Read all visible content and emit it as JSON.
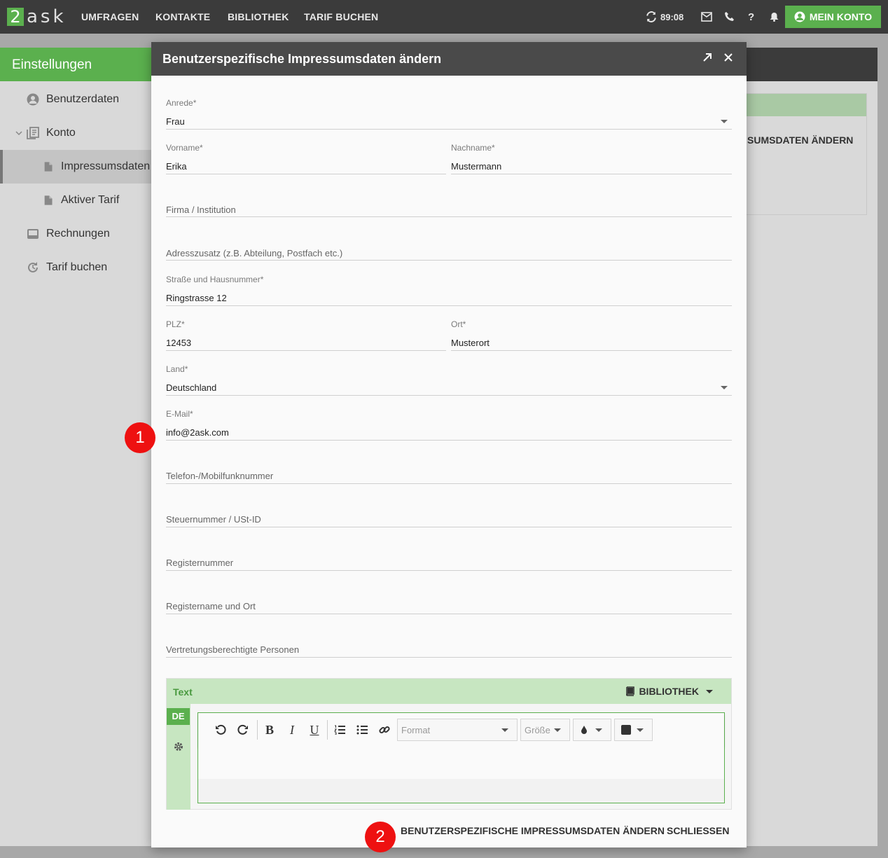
{
  "nav": {
    "logo_digit": "2",
    "logo_text": "ask",
    "items": [
      "UMFRAGEN",
      "KONTAKTE",
      "BIBLIOTHEK",
      "TARIF BUCHEN"
    ],
    "timer": "89:08",
    "account_label": "MEIN KONTO"
  },
  "sidebar": {
    "title": "Einstellungen",
    "items": [
      {
        "label": "Benutzerdaten",
        "icon": "user-circle-icon"
      },
      {
        "label": "Konto",
        "icon": "documents-icon"
      },
      {
        "label": "Impressumsdaten",
        "icon": "file-icon"
      },
      {
        "label": "Aktiver Tarif",
        "icon": "file-icon"
      },
      {
        "label": "Rechnungen",
        "icon": "inbox-icon"
      },
      {
        "label": "Tarif buchen",
        "icon": "refresh-clock-icon"
      }
    ]
  },
  "background_card": {
    "action_text": "SUMSDATEN ÄNDERN"
  },
  "modal": {
    "title": "Benutzerspezifische Impressumsdaten ändern",
    "fields": {
      "anrede": {
        "label": "Anrede*",
        "value": "Frau"
      },
      "vorname": {
        "label": "Vorname*",
        "value": "Erika"
      },
      "nachname": {
        "label": "Nachname*",
        "value": "Mustermann"
      },
      "firma": {
        "label": "Firma / Institution",
        "value": ""
      },
      "adresszusatz": {
        "label": "Adresszusatz (z.B. Abteilung, Postfach etc.)",
        "value": ""
      },
      "strasse": {
        "label": "Straße und Hausnummer*",
        "value": "Ringstrasse 12"
      },
      "plz": {
        "label": "PLZ*",
        "value": "12453"
      },
      "ort": {
        "label": "Ort*",
        "value": "Musterort"
      },
      "land": {
        "label": "Land*",
        "value": "Deutschland"
      },
      "email": {
        "label": "E-Mail*",
        "value": "info@2ask.com"
      },
      "telefon": {
        "label": "Telefon-/Mobilfunknummer",
        "value": ""
      },
      "steuer": {
        "label": "Steuernummer / USt-ID",
        "value": ""
      },
      "registernummer": {
        "label": "Registernummer",
        "value": ""
      },
      "registername": {
        "label": "Registername und Ort",
        "value": ""
      },
      "vertretung": {
        "label": "Vertretungsberechtigte Personen",
        "value": ""
      }
    },
    "editor": {
      "section_label": "Text",
      "library_label": "BIBLIOTHEK",
      "language": "DE",
      "format_placeholder": "Format",
      "size_placeholder": "Größe"
    },
    "buttons": {
      "submit": "BENUTZERSPEZIFISCHE IMPRESSUMSDATEN ÄNDERN",
      "close": "SCHLIESSEN"
    }
  },
  "annotations": [
    "1",
    "2"
  ],
  "colors": {
    "brand_green": "#5bb04e",
    "light_green": "#c7e6c1",
    "header_dark": "#3b3b3b",
    "badge_red": "#ee1111"
  }
}
